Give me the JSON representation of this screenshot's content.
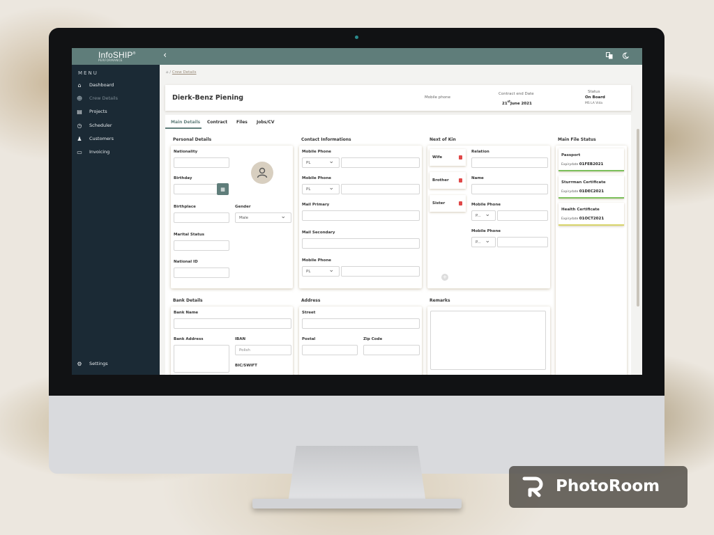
{
  "app": {
    "logo": "InfoSHIP",
    "logo_reg": "®",
    "logo_sub": "PERFORMANCE"
  },
  "topbar": {
    "back_icon": "chevron-left-icon",
    "translate_icon": "translate-icon",
    "theme_icon": "moon-icon"
  },
  "sidebar": {
    "menu_title": "MENU",
    "items": [
      {
        "label": "Dashboard",
        "icon": "home-icon"
      },
      {
        "label": "Crew Details",
        "icon": "crew-icon",
        "active": true
      },
      {
        "label": "Projects",
        "icon": "projects-icon"
      },
      {
        "label": "Scheduler",
        "icon": "clock-icon"
      },
      {
        "label": "Customers",
        "icon": "users-icon"
      },
      {
        "label": "Invoicing",
        "icon": "card-icon"
      }
    ],
    "settings_label": "Settings"
  },
  "breadcrumb": {
    "sep": "/",
    "current": "Crew Details"
  },
  "header": {
    "name": "Dierk-Benz Piening",
    "mobile_label": "Mobile phone",
    "contract_label": "Contract end Date",
    "contract_day": "21",
    "contract_sup": "st",
    "contract_rest": "June 2021",
    "status_label": "Status",
    "status_value": "On Board",
    "status_vessel": "MS LA Vida"
  },
  "tabs": [
    "Main Details",
    "Contract",
    "Files",
    "Jobs/CV"
  ],
  "personal": {
    "title": "Personal Details",
    "nationality": "Nationality",
    "birthday": "Birthday",
    "birthplace": "Birthplace",
    "gender": "Gender",
    "gender_value": "Male",
    "marital": "Marital Status",
    "national_id": "National ID"
  },
  "contact": {
    "title": "Contact Informations",
    "mobile1": "Mobile Phone",
    "mobile2": "Mobile Phone",
    "mail_primary": "Mail Primary",
    "mail_secondary": "Mail Secondary",
    "mobile3": "Mobile Phone",
    "country_code": "PL"
  },
  "kin": {
    "title": "Next of Kin",
    "people": [
      "Wife",
      "Brother",
      "Sister"
    ],
    "relation": "Relation",
    "name": "Name",
    "mobile1": "Mobile Phone",
    "mobile2": "Mobile Phone",
    "code_short": "P..."
  },
  "files": {
    "title": "Main File Status",
    "expiry_label": "Expirydate",
    "items": [
      {
        "name": "Passport",
        "date": "01FEB2021",
        "status_color": "#7bbf5a"
      },
      {
        "name": "Sturrman Certificate",
        "date": "01DEC2021",
        "status_color": "#7bbf5a"
      },
      {
        "name": "Health Certificate",
        "date": "01OCT2021",
        "status_color": "#d8d46a"
      }
    ]
  },
  "bank": {
    "title": "Bank Details",
    "bank_name": "Bank Name",
    "bank_address": "Bank Address",
    "iban": "IBAN",
    "iban_placeholder": "Polish",
    "bic": "BIC/SWIFT"
  },
  "address": {
    "title": "Address",
    "street": "Street",
    "postal": "Postal",
    "zip": "Zip Code"
  },
  "remarks": {
    "title": "Remarks"
  },
  "watermark": {
    "text": "PhotoRoom"
  },
  "colors": {
    "accent": "#5f7d7a",
    "sidebar": "#1b2a35",
    "danger": "#e04848"
  }
}
